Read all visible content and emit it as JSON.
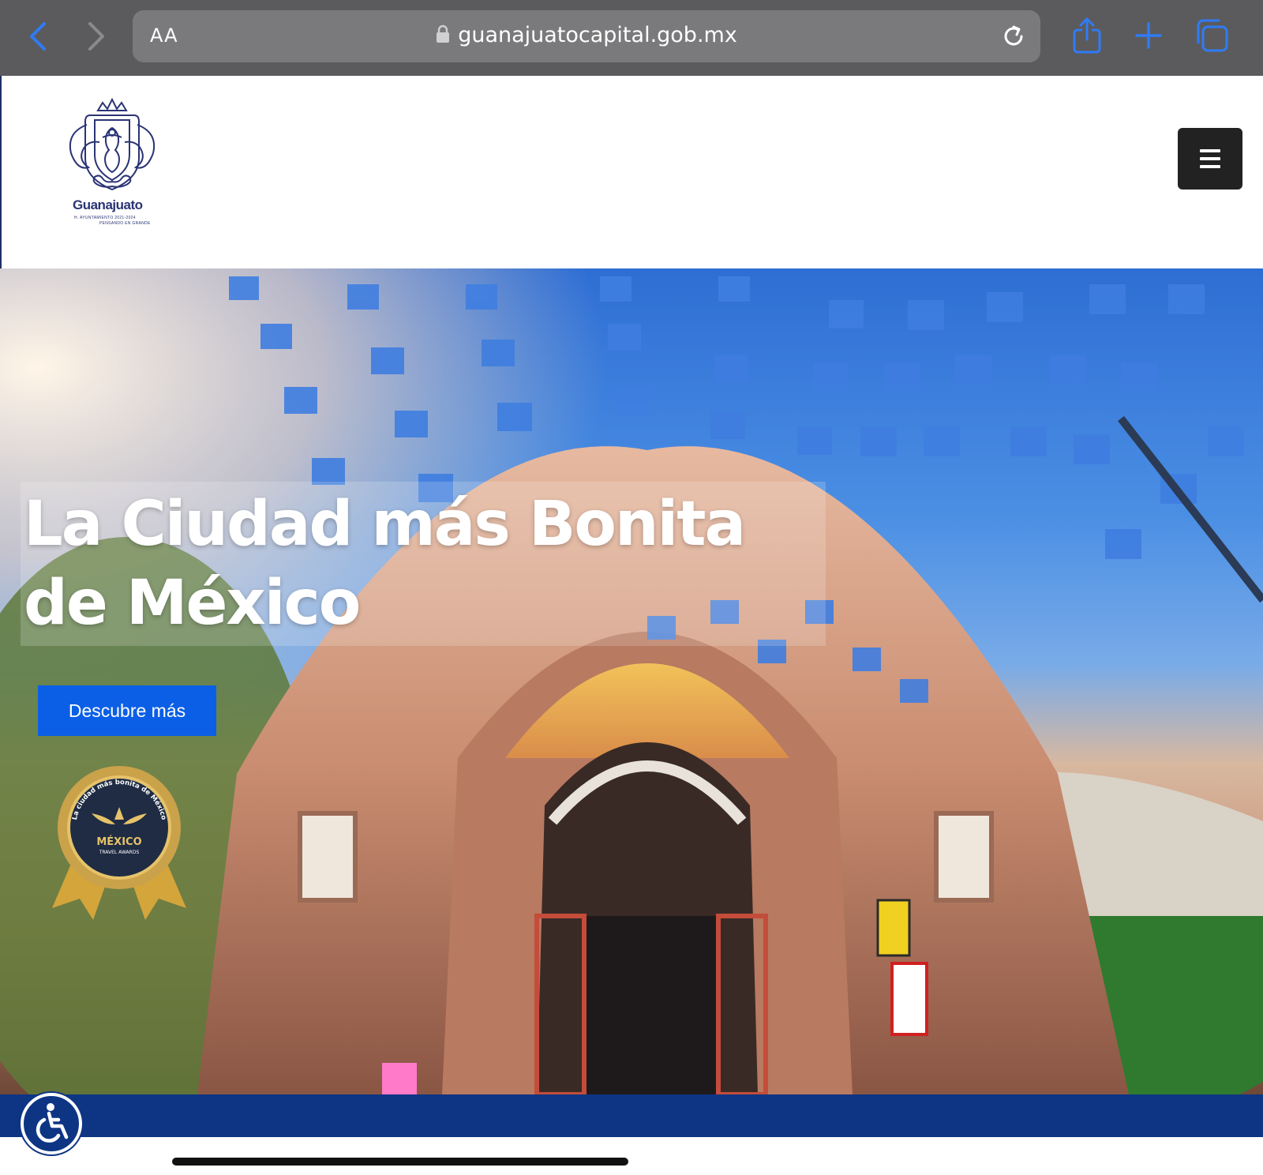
{
  "browser": {
    "aa_label": "AA",
    "url": "guanajuatocapital.gob.mx",
    "icons": [
      "back-icon",
      "forward-icon",
      "lock-icon",
      "reload-icon",
      "share-icon",
      "new-tab-icon",
      "tabs-icon"
    ]
  },
  "header": {
    "logo_name": "Guanajuato",
    "logo_sub": "H. AYUNTAMIENTO 2021-2024",
    "logo_tagline": "PENSANDO EN GRANDE",
    "menu_icon": "hamburger-icon"
  },
  "hero": {
    "title": "La Ciudad más Bonita de México",
    "cta_label": "Descubre más",
    "award": {
      "arc_text": "La ciudad más bonita de México",
      "label": "MÉXICO",
      "sublabel": "TRAVEL AWARDS"
    }
  },
  "footer": {
    "accessibility_icon": "wheelchair-icon"
  },
  "colors": {
    "chrome_bg": "#5b5b5d",
    "urlbar_bg": "#7a7a7c",
    "nav_accent": "#2f7bf6",
    "menu_button": "#222222",
    "cta": "#0b5fe6",
    "footer_bar": "#0d3584",
    "logo_navy": "#2a3475"
  }
}
